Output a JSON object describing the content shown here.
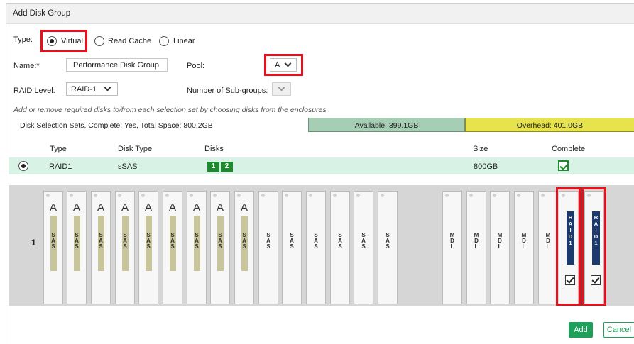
{
  "dialog": {
    "title": "Add Disk Group"
  },
  "type": {
    "label": "Type:",
    "options": [
      "Virtual",
      "Read Cache",
      "Linear"
    ],
    "selected": "Virtual"
  },
  "name": {
    "label": "Name:*",
    "value": "Performance Disk Group"
  },
  "pool": {
    "label": "Pool:",
    "value": "A"
  },
  "raid": {
    "label": "RAID Level:",
    "value": "RAID-1"
  },
  "subgroups": {
    "label": "Number of Sub-groups:",
    "value": ""
  },
  "hint": "Add or remove required disks to/from each selection set by choosing disks from the enclosures",
  "summary": {
    "text": "Disk Selection Sets, Complete: Yes, Total Space: 800.2GB",
    "available": "Available: 399.1GB",
    "overhead": "Overhead: 401.0GB"
  },
  "table": {
    "headers": {
      "type": "Type",
      "disk_type": "Disk Type",
      "disks": "Disks",
      "size": "Size",
      "complete": "Complete"
    },
    "rows": [
      {
        "type": "RAID1",
        "disk_type": "sSAS",
        "disks": [
          "1",
          "2"
        ],
        "size": "800GB",
        "complete": true
      }
    ]
  },
  "enclosure": {
    "label": "1",
    "assigned_letter": "A",
    "sas_label": [
      "S",
      "A",
      "S"
    ],
    "mdl_label": [
      "M",
      "D",
      "L"
    ],
    "raid_label": [
      "R",
      "A",
      "I",
      "D",
      "1"
    ],
    "slots_assigned_sas": 9,
    "slots_free_sas": 6,
    "slots_mdl": 5,
    "slots_selected_raid": 2
  },
  "buttons": {
    "add": "Add",
    "cancel": "Cancel"
  },
  "colors": {
    "accent": "#1ea05a",
    "available": "#a6ceb5",
    "overhead": "#e6e34c",
    "highlight": "#e8101a",
    "raid": "#1b3a6b"
  }
}
